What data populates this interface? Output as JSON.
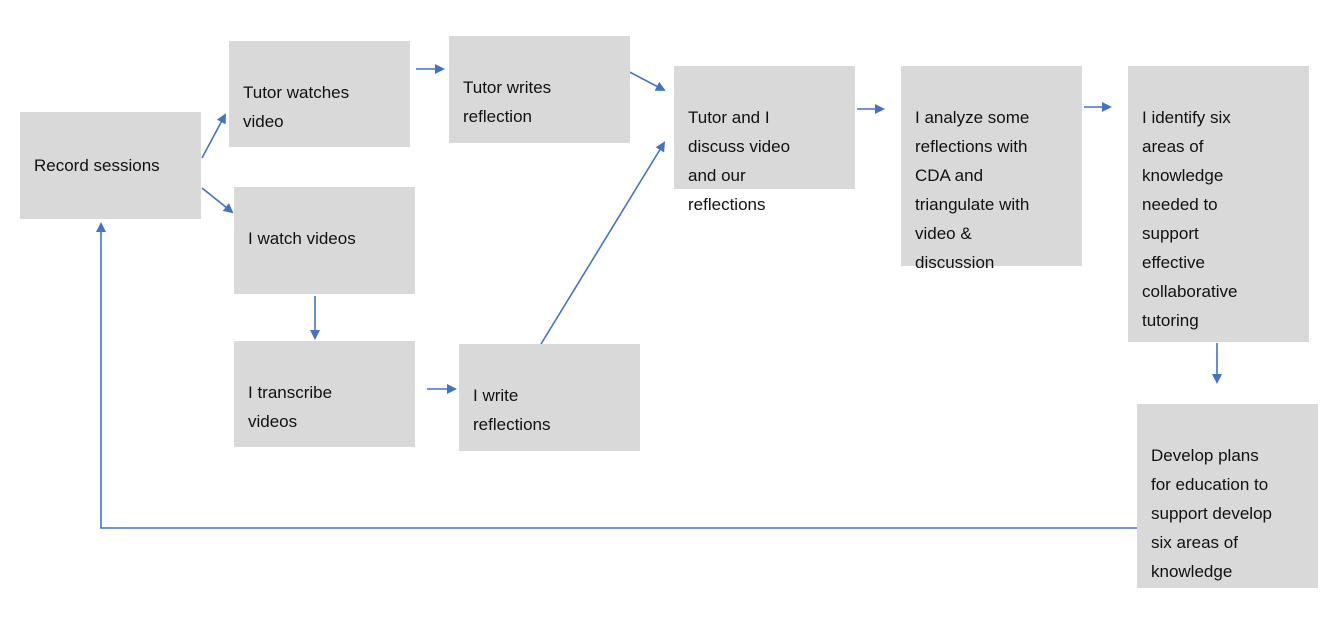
{
  "diagram": {
    "colors": {
      "box_fill": "#D9D9D9",
      "arrow": "#4472C4",
      "text": "#111111"
    },
    "nodes": {
      "record": "Record sessions",
      "tutor_watch": "Tutor watches\nvideo",
      "tutor_write": "Tutor writes\nreflection",
      "i_watch": "I watch videos",
      "i_transcribe": "I transcribe\nvideos",
      "i_write": "I write\nreflections",
      "discuss": "Tutor and I\ndiscuss video\nand our\nreflections",
      "analyze": "I analyze some\nreflections with\nCDA and\ntriangulate with\nvideo &\ndiscussion",
      "identify": "I identify six\nareas of\nknowledge\nneeded to\nsupport\neffective\ncollaborative\ntutoring",
      "develop": "Develop plans\nfor education to\nsupport develop\nsix areas of\nknowledge"
    },
    "edges": [
      {
        "from": "record",
        "to": "tutor_watch"
      },
      {
        "from": "record",
        "to": "i_watch"
      },
      {
        "from": "tutor_watch",
        "to": "tutor_write"
      },
      {
        "from": "tutor_write",
        "to": "discuss"
      },
      {
        "from": "i_watch",
        "to": "i_transcribe"
      },
      {
        "from": "i_transcribe",
        "to": "i_write"
      },
      {
        "from": "i_write",
        "to": "discuss"
      },
      {
        "from": "discuss",
        "to": "analyze"
      },
      {
        "from": "analyze",
        "to": "identify"
      },
      {
        "from": "identify",
        "to": "develop"
      },
      {
        "from": "develop",
        "to": "record"
      }
    ]
  }
}
